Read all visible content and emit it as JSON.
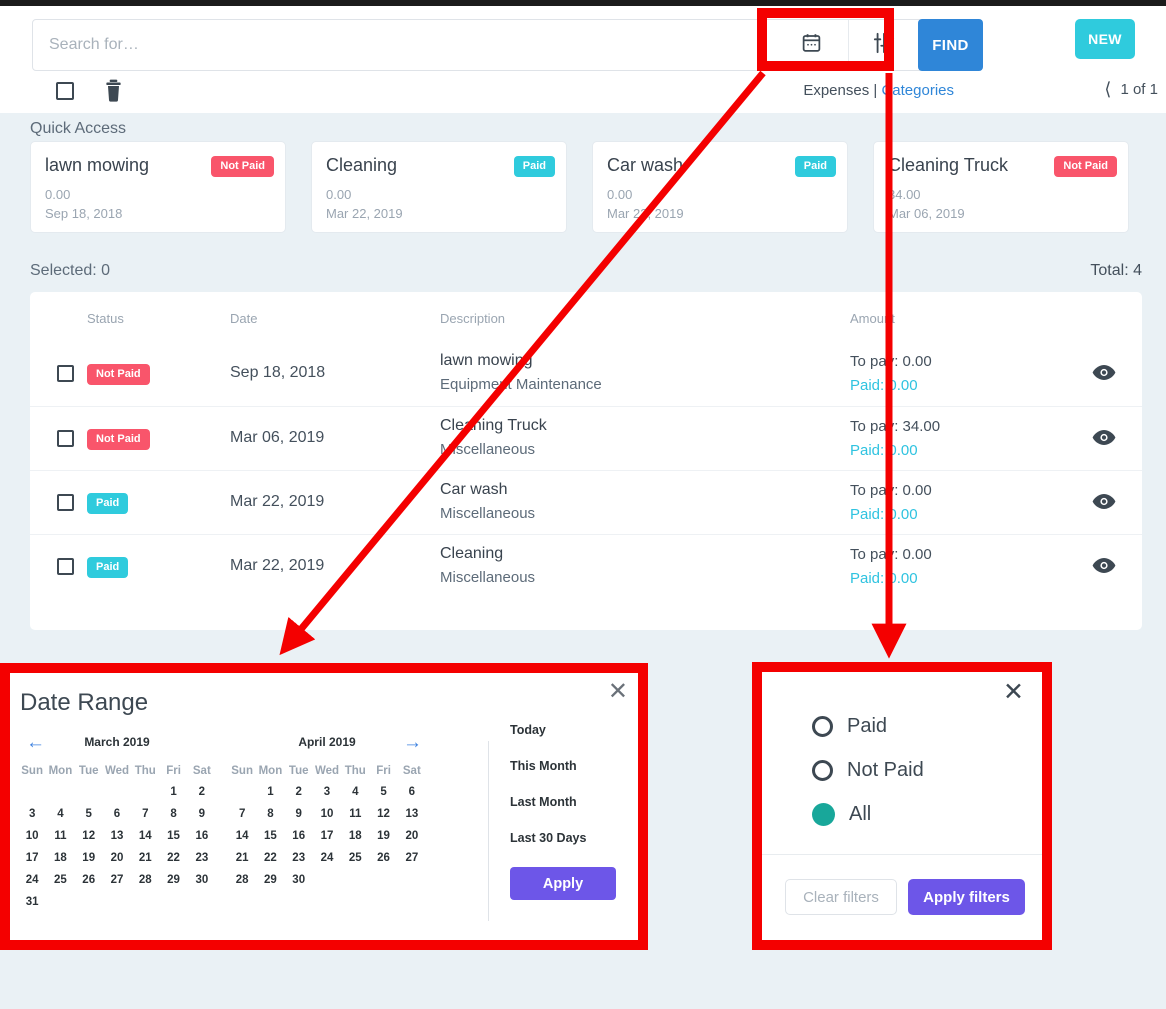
{
  "header": {
    "search": {
      "placeholder": "Search for…",
      "value": ""
    },
    "calendar_icon": "calendar-icon",
    "filter_icon": "sliders-filter-icon",
    "find_label": "FIND",
    "new_label": "NEW",
    "select_all_icon": "checkbox-icon",
    "delete_icon": "trash-icon",
    "breadcrumb": {
      "current": "Expenses",
      "separator": "|",
      "link": "Categories"
    },
    "pager": {
      "prev_icon": "chevron-left-icon",
      "text": "1 of 1",
      "next_icon": "chevron-right-icon"
    }
  },
  "quick_access": {
    "label": "Quick Access",
    "cards": [
      {
        "title": "lawn mowing",
        "status": "Not Paid",
        "status_kind": "np",
        "amount": "0.00",
        "date": "Sep 18, 2018"
      },
      {
        "title": "Cleaning",
        "status": "Paid",
        "status_kind": "p",
        "amount": "0.00",
        "date": "Mar 22, 2019"
      },
      {
        "title": "Car wash",
        "status": "Paid",
        "status_kind": "p",
        "amount": "0.00",
        "date": "Mar 22, 2019"
      },
      {
        "title": "Cleaning Truck",
        "status": "Not Paid",
        "status_kind": "np",
        "amount": "34.00",
        "date": "Mar 06, 2019"
      }
    ]
  },
  "selection": {
    "selected": "Selected: 0",
    "total": "Total: 4"
  },
  "table": {
    "columns": [
      "Status",
      "Date",
      "Description",
      "Amount"
    ],
    "rows": [
      {
        "status": "Not Paid",
        "status_kind": "np",
        "date": "Sep 18, 2018",
        "title": "lawn mowing",
        "category": "Equipment Maintenance",
        "to_pay": "To pay: 0.00",
        "paid": "Paid: 0.00",
        "view_icon": "eye-icon"
      },
      {
        "status": "Not Paid",
        "status_kind": "np",
        "date": "Mar 06, 2019",
        "title": "Cleaning Truck",
        "category": "Miscellaneous",
        "to_pay": "To pay: 34.00",
        "paid": "Paid: 0.00",
        "view_icon": "eye-icon"
      },
      {
        "status": "Paid",
        "status_kind": "p",
        "date": "Mar 22, 2019",
        "title": "Car wash",
        "category": "Miscellaneous",
        "to_pay": "To pay: 0.00",
        "paid": "Paid: 0.00",
        "view_icon": "eye-icon"
      },
      {
        "status": "Paid",
        "status_kind": "p",
        "date": "Mar 22, 2019",
        "title": "Cleaning",
        "category": "Miscellaneous",
        "to_pay": "To pay: 0.00",
        "paid": "Paid: 0.00",
        "view_icon": "eye-icon"
      }
    ]
  },
  "date_range_popup": {
    "title": "Date Range",
    "close_icon": "close-icon",
    "prev_icon": "arrow-left-icon",
    "next_icon": "arrow-right-icon",
    "dow": [
      "Sun",
      "Mon",
      "Tue",
      "Wed",
      "Thu",
      "Fri",
      "Sat"
    ],
    "months": [
      {
        "label": "March 2019",
        "lead_blanks": 5,
        "days": 31
      },
      {
        "label": "April 2019",
        "lead_blanks": 1,
        "days": 30
      }
    ],
    "presets": [
      "Today",
      "This Month",
      "Last Month",
      "Last 30 Days"
    ],
    "apply_label": "Apply"
  },
  "filters_popup": {
    "close_icon": "close-icon",
    "options": [
      {
        "label": "Paid",
        "selected": false
      },
      {
        "label": "Not Paid",
        "selected": false
      },
      {
        "label": "All",
        "selected": true
      }
    ],
    "clear_label": "Clear filters",
    "apply_label": "Apply filters"
  },
  "annotations": {
    "highlight_color": "#f40000",
    "boxes": [
      "header-icon-group",
      "date-range-popup",
      "filters-popup"
    ],
    "arrows": [
      "calendar-icon-to-date-range-popup",
      "filter-icon-to-filters-popup"
    ]
  },
  "colors": {
    "page_bg": "#eaf1f5",
    "accent_blue": "#2f86d8",
    "accent_cyan": "#2fcbdd",
    "danger": "#f9556b",
    "purple": "#6d56e8",
    "teal": "#18a79a"
  }
}
